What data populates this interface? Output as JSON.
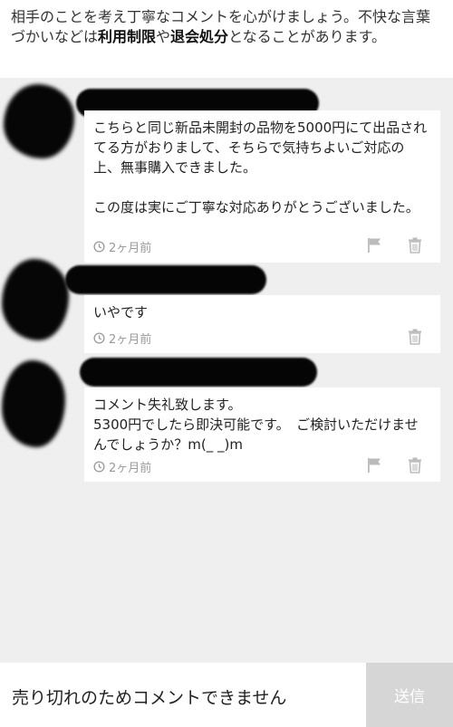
{
  "notice": {
    "part1": "相手のことを考え丁寧なコメントを心がけましょう。不快な言葉づかいなどは",
    "bold1": "利用制限",
    "part2": "や",
    "bold2": "退会処分",
    "part3": "となることがあります。"
  },
  "comments": [
    {
      "text": "こちらと同じ新品未開封の品物を5000円にて出品されてる方がおりまして、そちらで気持ちよいご対応の上、無事購入できました。\n\nこの度は実にご丁寧な対応ありがとうございました。",
      "time": "2ヶ月前",
      "has_report": true
    },
    {
      "text": "いやです",
      "time": "2ヶ月前",
      "has_report": false
    },
    {
      "text": "コメント失礼致します。\n5300円でしたら即決可能です。　ご検討いただけませんでしょうか？m(_ _)m",
      "time": "2ヶ月前",
      "has_report": true
    }
  ],
  "footer": {
    "closed_text": "売り切れのためコメントできません",
    "send_label": "送信"
  },
  "colors": {
    "background": "#efefef",
    "card": "#ffffff",
    "meta_text": "#999999",
    "send_disabled": "#d6d6d6"
  }
}
